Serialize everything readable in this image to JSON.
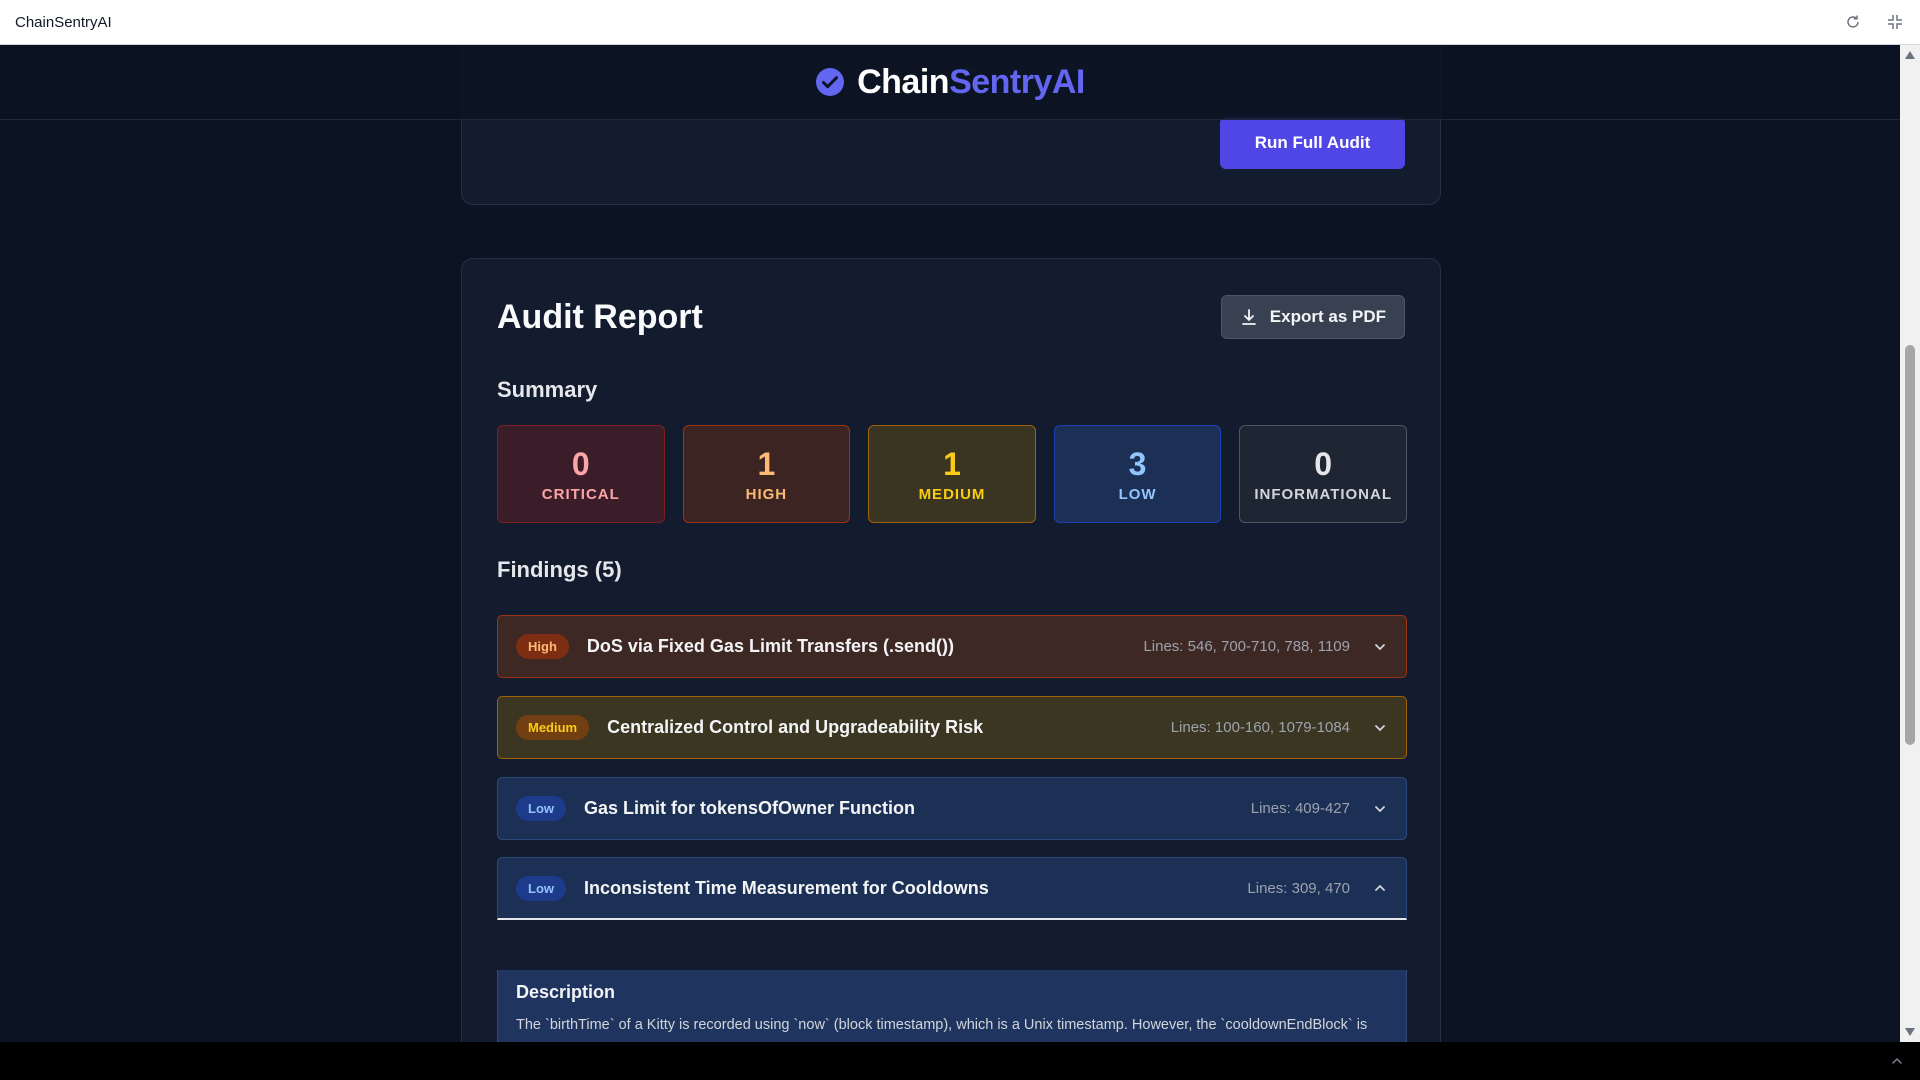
{
  "window": {
    "title": "ChainSentryAI"
  },
  "header": {
    "brand_main": "Chain",
    "brand_accent": "SentryAI"
  },
  "top_card": {
    "run_label": "Run Full Audit"
  },
  "report": {
    "title": "Audit Report",
    "export_label": "Export as PDF",
    "summary_title": "Summary",
    "summary": [
      {
        "count": "0",
        "label": "CRITICAL"
      },
      {
        "count": "1",
        "label": "HIGH"
      },
      {
        "count": "1",
        "label": "MEDIUM"
      },
      {
        "count": "3",
        "label": "LOW"
      },
      {
        "count": "0",
        "label": "INFORMATIONAL"
      }
    ],
    "findings_title": "Findings (5)",
    "findings": [
      {
        "severity": "High",
        "title": "DoS via Fixed Gas Limit Transfers (.send())",
        "lines": "Lines: 546, 700-710, 788, 1109"
      },
      {
        "severity": "Medium",
        "title": "Centralized Control and Upgradeability Risk",
        "lines": "Lines: 100-160, 1079-1084"
      },
      {
        "severity": "Low",
        "title": "Gas Limit for tokensOfOwner Function",
        "lines": "Lines: 409-427"
      },
      {
        "severity": "Low",
        "title": "Inconsistent Time Measurement for Cooldowns",
        "lines": "Lines: 309, 470"
      }
    ],
    "expanded": {
      "description_title": "Description",
      "description_text": "The `birthTime` of a Kitty is recorded using `now` (block timestamp), which is a Unix timestamp. However, the `cooldownEndBlock` is calculated using `block.number` and a `secondsPerBlock` approximation (`cooldowns[_kitten.cooldownIndex]/secondsPerBlock) + block.number`)."
    }
  },
  "colors": {
    "accent": "#6366f1",
    "critical": "#fca5a5",
    "high": "#fdba74",
    "medium": "#facc15",
    "low": "#93c5fd",
    "info": "#d1d5db"
  }
}
